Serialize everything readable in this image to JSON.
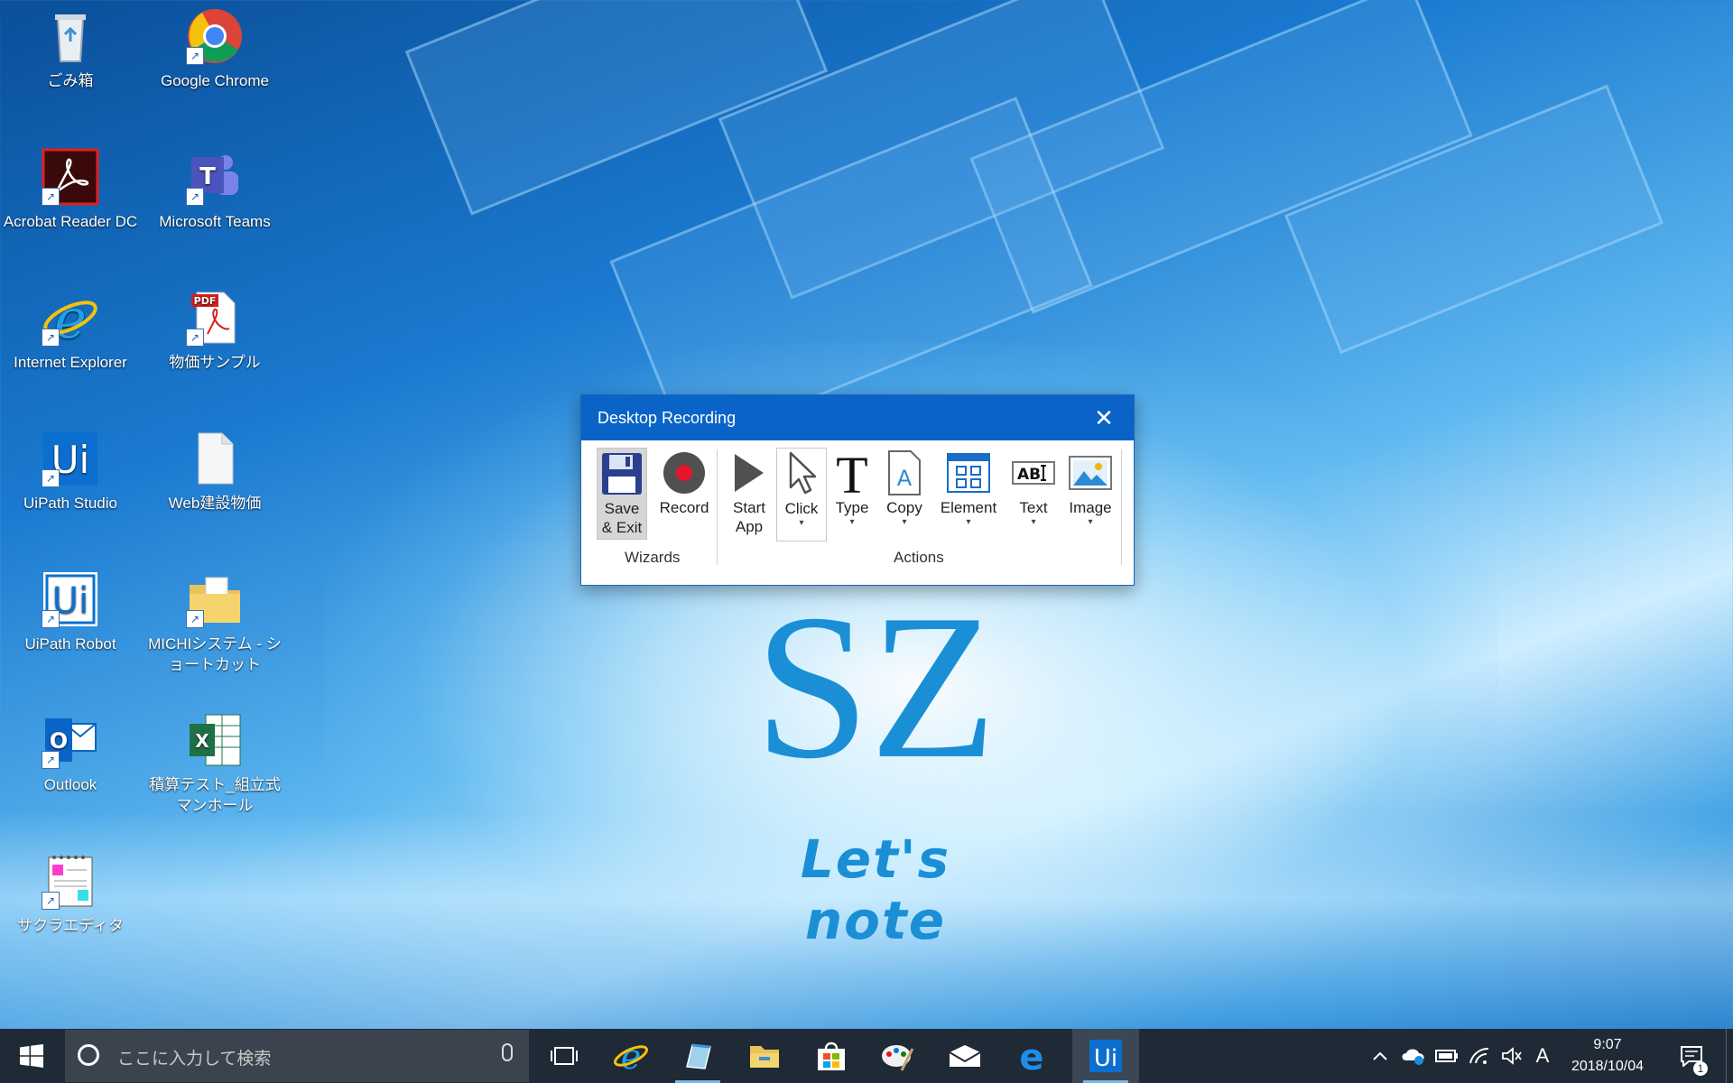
{
  "desktop": {
    "icons": [
      {
        "label": "ごみ箱",
        "icon": "recycle-bin-icon"
      },
      {
        "label": "Google Chrome",
        "icon": "chrome-icon"
      },
      {
        "label": "Acrobat Reader DC",
        "icon": "acrobat-icon"
      },
      {
        "label": "Microsoft Teams",
        "icon": "teams-icon"
      },
      {
        "label": "Internet Explorer",
        "icon": "internet-explorer-icon"
      },
      {
        "label": "物価サンプル",
        "icon": "pdf-file-icon"
      },
      {
        "label": "UiPath Studio",
        "icon": "uipath-studio-icon"
      },
      {
        "label": "Web建設物価",
        "icon": "document-icon"
      },
      {
        "label": "UiPath Robot",
        "icon": "uipath-robot-icon"
      },
      {
        "label": "MICHIシステム - ショートカット",
        "icon": "folder-icon"
      },
      {
        "label": "Outlook",
        "icon": "outlook-icon"
      },
      {
        "label": "積算テスト_組立式マンホール",
        "icon": "excel-icon"
      },
      {
        "label": "サクラエディタ",
        "icon": "sakura-editor-icon"
      }
    ],
    "wallpaper_logo": {
      "main": "SZ",
      "sub": "Let's note"
    }
  },
  "recording_window": {
    "title": "Desktop Recording",
    "close_glyph": "✕",
    "wizards_group_label": "Wizards",
    "actions_group_label": "Actions",
    "tools": {
      "save_exit": "Save & Exit",
      "record": "Record",
      "start_app": "Start App",
      "click": "Click",
      "type": "Type",
      "copy": "Copy",
      "element": "Element",
      "text": "Text",
      "image": "Image"
    },
    "text_icon_label": "AB",
    "type_icon_glyph": "T",
    "copy_icon_glyph": "A",
    "caret_glyph": "▾"
  },
  "taskbar": {
    "search_placeholder": "ここに入力して検索",
    "apps": [
      "task-view-icon",
      "internet-explorer-icon",
      "sakura-editor-icon",
      "file-explorer-icon",
      "store-icon",
      "paint-icon",
      "mail-icon",
      "edge-icon",
      "uipath-icon"
    ],
    "tray": {
      "chevron": "^",
      "ime": "A",
      "time": "9:07",
      "date": "2018/10/04",
      "notification_count": "1"
    }
  },
  "colors": {
    "window_title_bg": "#0a64c8",
    "taskbar_bg": "#1f2a36",
    "accent": "#1a8fd6"
  }
}
